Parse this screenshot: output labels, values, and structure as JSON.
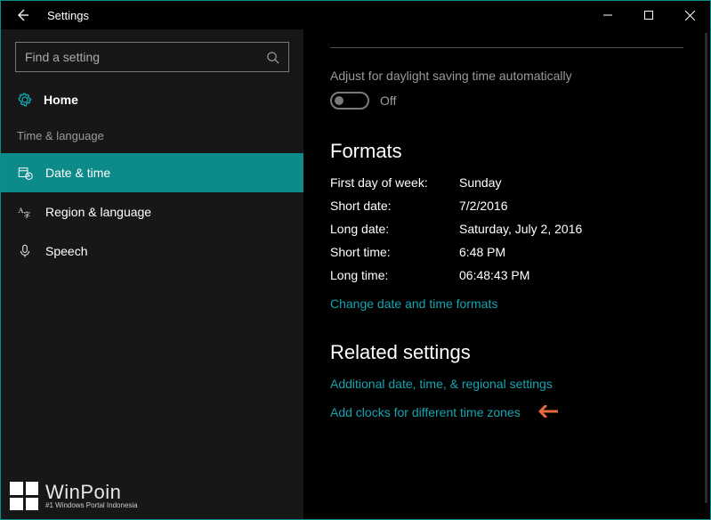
{
  "window": {
    "title": "Settings"
  },
  "search": {
    "placeholder": "Find a setting"
  },
  "home_label": "Home",
  "category_label": "Time & language",
  "nav": [
    {
      "label": "Date & time",
      "icon": "calendar-clock-icon",
      "active": true
    },
    {
      "label": "Region & language",
      "icon": "language-icon",
      "active": false
    },
    {
      "label": "Speech",
      "icon": "microphone-icon",
      "active": false
    }
  ],
  "dst": {
    "label": "Adjust for daylight saving time automatically",
    "state": "Off"
  },
  "formats": {
    "heading": "Formats",
    "rows": [
      {
        "key": "First day of week:",
        "val": "Sunday"
      },
      {
        "key": "Short date:",
        "val": "7/2/2016"
      },
      {
        "key": "Long date:",
        "val": "Saturday, July 2, 2016"
      },
      {
        "key": "Short time:",
        "val": "6:48 PM"
      },
      {
        "key": "Long time:",
        "val": "06:48:43 PM"
      }
    ],
    "change_link": "Change date and time formats"
  },
  "related": {
    "heading": "Related settings",
    "link1": "Additional date, time, & regional settings",
    "link2": "Add clocks for different time zones"
  },
  "watermark": {
    "main": "WinPoin",
    "sub": "#1 Windows Portal Indonesia"
  }
}
